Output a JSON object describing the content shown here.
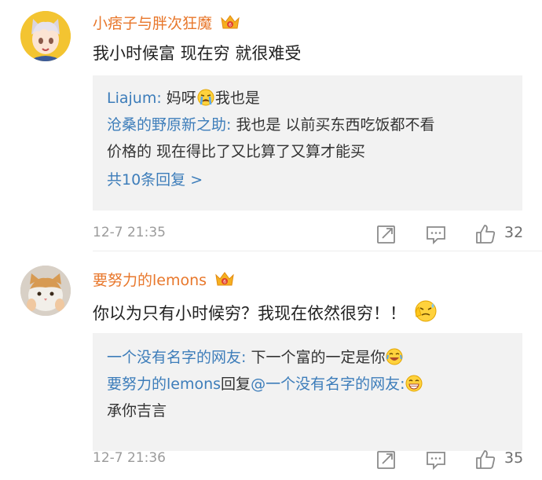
{
  "comments": [
    {
      "username": "小痞子与胖次狂魔",
      "text": "我小时候富 现在穷 就很难受",
      "avatar": "anime-avatar",
      "replies": [
        {
          "name": "Liajum",
          "text_before": "妈呀",
          "emoji": "crying-emoji",
          "text_after": "我也是"
        },
        {
          "name": "沧桑的野原新之助",
          "text_line1": "我也是 以前买东西吃饭都不看",
          "text_line2": "价格的 现在得比了又比算了又算才能买"
        }
      ],
      "more_label": "共10条回复 >",
      "time": "12-7 21:35",
      "likes": "32"
    },
    {
      "username": "要努力的lemons",
      "text": "你以为只有小时候穷？我现在依然很穷！！",
      "avatar": "cat-avatar",
      "replies": [
        {
          "name": "一个没有名字的网友",
          "text": "下一个富的一定是你",
          "emoji": "laughing-emoji"
        },
        {
          "name": "要努力的lemons",
          "reply_word": "回复",
          "mention": "@一个没有名字的网友",
          "emoji": "grinning-emoji",
          "text_line2": "承你吉言"
        }
      ],
      "time": "12-7 21:36",
      "likes": "35"
    }
  ],
  "colors": {
    "username": "#e8772b",
    "reply_name": "#3d7dba",
    "reply_bg": "#f2f2f2",
    "meta": "#9b9b9b"
  }
}
